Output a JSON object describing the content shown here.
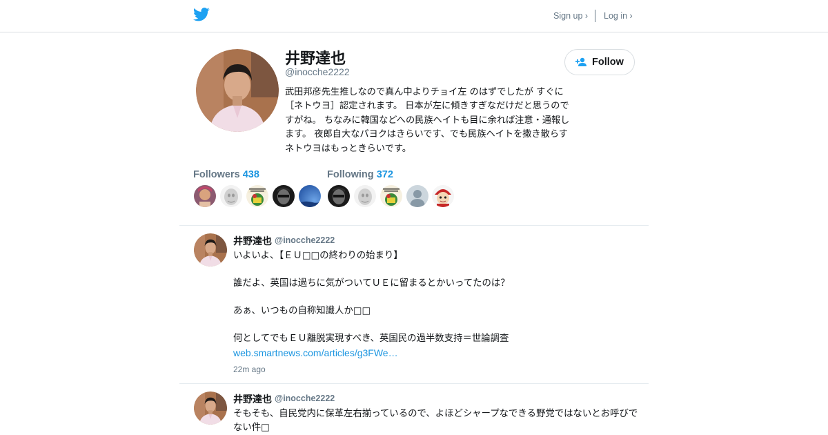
{
  "header": {
    "signup_label": "Sign up ›",
    "login_label": "Log in ›",
    "brand_color": "#1da1f2",
    "logo_icon": "twitter-bird-icon"
  },
  "profile": {
    "name": "井野達也",
    "handle": "@inocche2222",
    "bio": "武田邦彦先生推しなので真ん中よりチョイ左 のはずでしたが すぐに［ネトウヨ］認定されます。 日本が左に傾きすぎなだけだと思うのですがね。 ちなみに韓国などへの民族ヘイトも目に余れば注意・通報します。 夜郎自大なパヨクはきらいです、でも民族ヘイトを撒き散らすネトウヨはもっときらいです。",
    "follow_label": "Follow",
    "follow_icon": "add-user-icon",
    "followers_label": "Followers",
    "followers_count": "438",
    "following_label": "Following",
    "following_count": "372",
    "stat_color": "#1b95e0"
  },
  "tweets": [
    {
      "name": "井野達也",
      "handle": "@inocche2222",
      "text": "いよいよ、【ＥＵ□□の終わりの始まり】\n\n誰だよ、英国は過ちに気がついてＵＥに留まるとかいってたのは？\n\nあぁ、いつもの自称知識人か□□\n\n何としてでもＥＵ離脱実現すべき、英国民の過半数支持＝世論調査",
      "link": "web.smartnews.com/articles/g3FWe…",
      "time": "22m ago"
    },
    {
      "name": "井野達也",
      "handle": "@inocche2222",
      "text": "そもそも、自民党内に保革左右揃っているので、よほどシャープなできる野党ではないとお呼びでない件□"
    }
  ]
}
